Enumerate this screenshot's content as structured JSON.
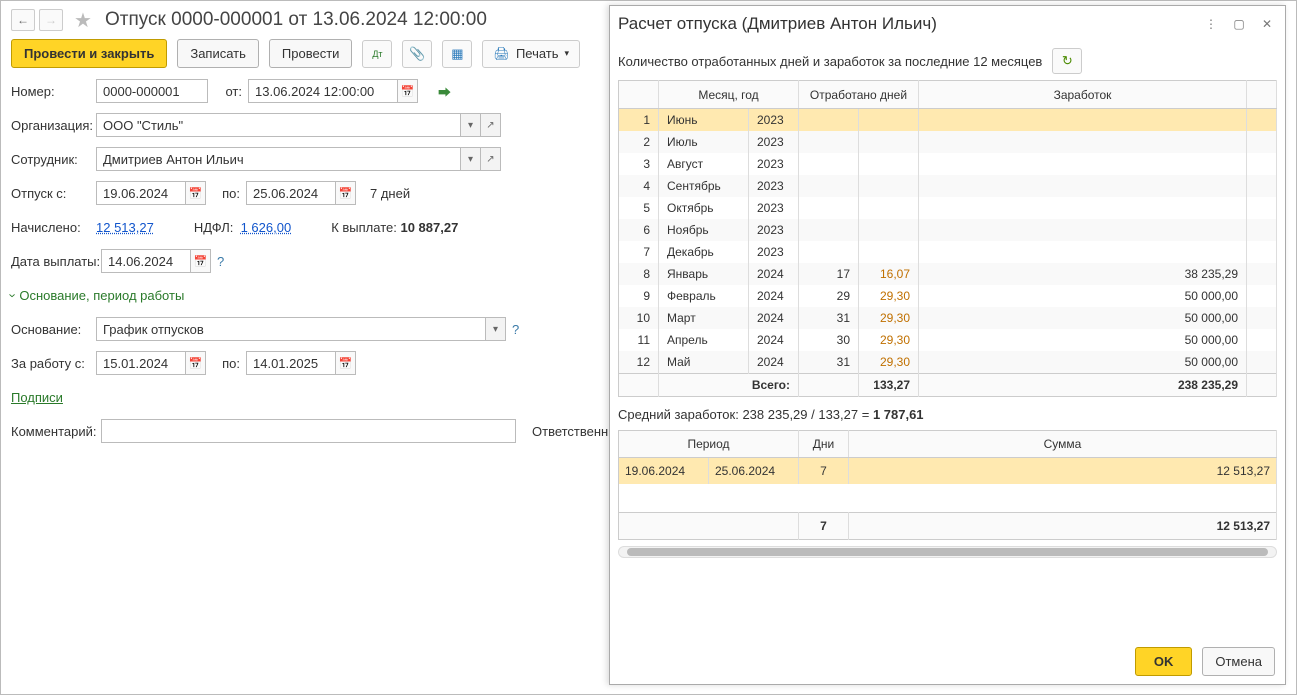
{
  "header": {
    "title": "Отпуск 0000-000001 от 13.06.2024 12:00:00"
  },
  "toolbar": {
    "primary": "Провести и закрыть",
    "save": "Записать",
    "post": "Провести",
    "print": "Печать"
  },
  "form": {
    "number_lbl": "Номер:",
    "number": "0000-000001",
    "from_lbl": "от:",
    "from": "13.06.2024 12:00:00",
    "org_lbl": "Организация:",
    "org": "ООО \"Стиль\"",
    "emp_lbl": "Сотрудник:",
    "emp": "Дмитриев Антон Ильич",
    "vac_from_lbl": "Отпуск с:",
    "vac_from": "19.06.2024",
    "vac_to_lbl": "по:",
    "vac_to": "25.06.2024",
    "vac_days": "7 дней",
    "accrued_lbl": "Начислено:",
    "accrued": "12 513,27",
    "ndfl_lbl": "НДФЛ:",
    "ndfl": "1 626,00",
    "topay_lbl": "К выплате:",
    "topay": "10 887,27",
    "paydate_lbl": "Дата выплаты:",
    "paydate": "14.06.2024",
    "basis_header": "Основание, период работы",
    "basis_lbl": "Основание:",
    "basis": "График отпусков",
    "work_from_lbl": "За работу с:",
    "work_from": "15.01.2024",
    "work_to_lbl": "по:",
    "work_to": "14.01.2025",
    "signatures": "Подписи",
    "comment_lbl": "Комментарий:",
    "resp_lbl": "Ответственный"
  },
  "panel": {
    "title": "Расчет отпуска (Дмитриев Антон Ильич)",
    "subtitle": "Количество отработанных дней и заработок за последние 12 месяцев",
    "thead": {
      "month": "Месяц, год",
      "days": "Отработано дней",
      "earn": "Заработок"
    },
    "rows": [
      {
        "n": "1",
        "m": "Июнь",
        "y": "2023",
        "d": "",
        "norm": "",
        "earn": ""
      },
      {
        "n": "2",
        "m": "Июль",
        "y": "2023",
        "d": "",
        "norm": "",
        "earn": ""
      },
      {
        "n": "3",
        "m": "Август",
        "y": "2023",
        "d": "",
        "norm": "",
        "earn": ""
      },
      {
        "n": "4",
        "m": "Сентябрь",
        "y": "2023",
        "d": "",
        "norm": "",
        "earn": ""
      },
      {
        "n": "5",
        "m": "Октябрь",
        "y": "2023",
        "d": "",
        "norm": "",
        "earn": ""
      },
      {
        "n": "6",
        "m": "Ноябрь",
        "y": "2023",
        "d": "",
        "norm": "",
        "earn": ""
      },
      {
        "n": "7",
        "m": "Декабрь",
        "y": "2023",
        "d": "",
        "norm": "",
        "earn": ""
      },
      {
        "n": "8",
        "m": "Январь",
        "y": "2024",
        "d": "17",
        "norm": "16,07",
        "earn": "38 235,29"
      },
      {
        "n": "9",
        "m": "Февраль",
        "y": "2024",
        "d": "29",
        "norm": "29,30",
        "earn": "50 000,00"
      },
      {
        "n": "10",
        "m": "Март",
        "y": "2024",
        "d": "31",
        "norm": "29,30",
        "earn": "50 000,00"
      },
      {
        "n": "11",
        "m": "Апрель",
        "y": "2024",
        "d": "30",
        "norm": "29,30",
        "earn": "50 000,00"
      },
      {
        "n": "12",
        "m": "Май",
        "y": "2024",
        "d": "31",
        "norm": "29,30",
        "earn": "50 000,00"
      }
    ],
    "foot": {
      "label": "Всего:",
      "norm": "133,27",
      "earn": "238 235,29"
    },
    "avg_pre": "Средний заработок: 238 235,29 / 133,27 = ",
    "avg_val": "1 787,61",
    "thead2": {
      "period": "Период",
      "days": "Дни",
      "sum": "Сумма"
    },
    "row2": {
      "from": "19.06.2024",
      "to": "25.06.2024",
      "days": "7",
      "sum": "12 513,27"
    },
    "foot2": {
      "days": "7",
      "sum": "12 513,27"
    },
    "ok": "OK",
    "cancel": "Отмена"
  }
}
